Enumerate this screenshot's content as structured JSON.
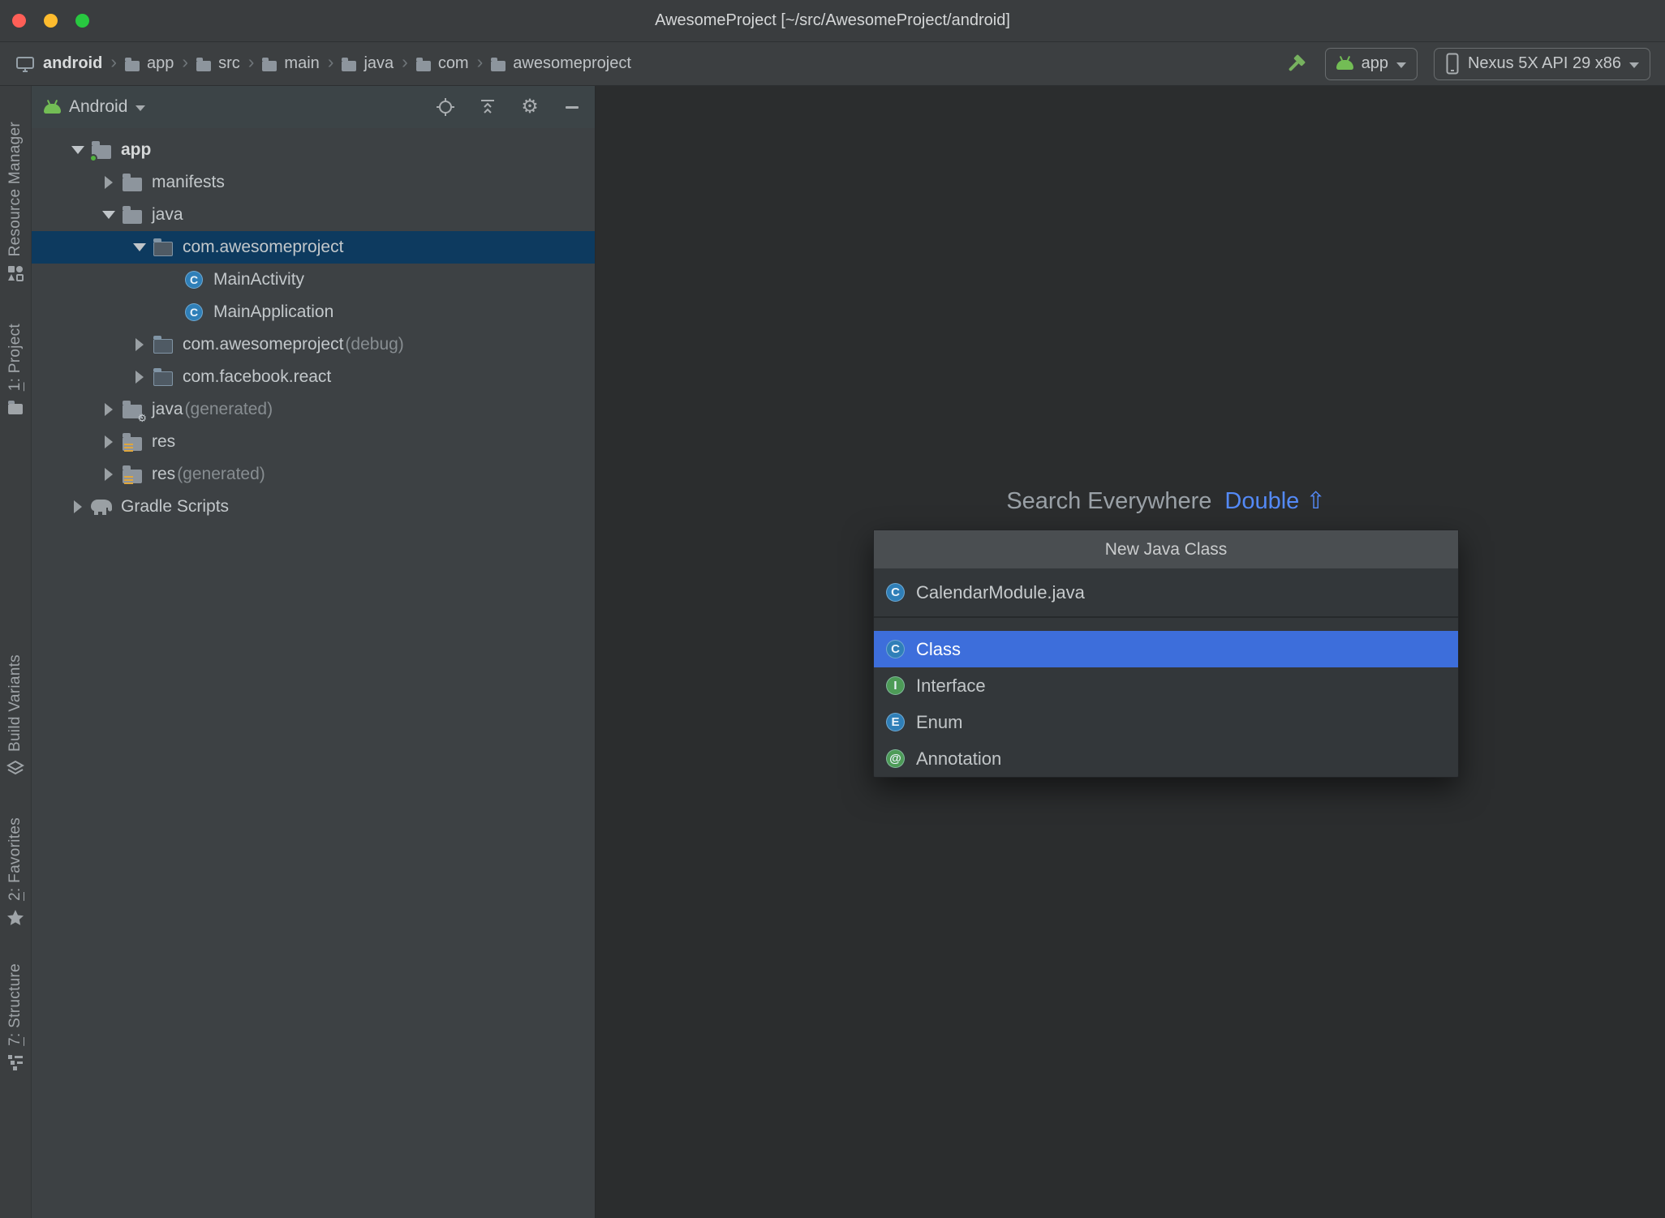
{
  "window": {
    "title": "AwesomeProject [~/src/AwesomeProject/android]"
  },
  "chrome": {
    "crumb_separator": "›"
  },
  "breadcrumbs": [
    "android",
    "app",
    "src",
    "main",
    "java",
    "com",
    "awesomeproject"
  ],
  "run_toolbar": {
    "config": "app",
    "device": "Nexus 5X API 29 x86"
  },
  "tool_window_header": {
    "view": "Android"
  },
  "tool_stripe": {
    "top": [
      {
        "mnemonic": "",
        "label": "Resource Manager"
      },
      {
        "mnemonic": "1",
        "label": ": Project"
      }
    ],
    "bottom": [
      {
        "mnemonic": "",
        "label": "Build Variants"
      },
      {
        "mnemonic": "2",
        "label": ": Favorites"
      },
      {
        "mnemonic": "7",
        "label": ": Structure"
      }
    ]
  },
  "icons": {
    "class_letter": "C"
  },
  "project_tree": {
    "items": [
      {
        "label": "app",
        "suffix": ""
      },
      {
        "label": "manifests",
        "suffix": ""
      },
      {
        "label": "java",
        "suffix": ""
      },
      {
        "label": "com.awesomeproject",
        "suffix": ""
      },
      {
        "label": "MainActivity",
        "suffix": ""
      },
      {
        "label": "MainApplication",
        "suffix": ""
      },
      {
        "label": "com.awesomeproject",
        "suffix": " (debug)"
      },
      {
        "label": "com.facebook.react",
        "suffix": ""
      },
      {
        "label": "java",
        "suffix": " (generated)"
      },
      {
        "label": "res",
        "suffix": ""
      },
      {
        "label": "res",
        "suffix": " (generated)"
      },
      {
        "label": "Gradle Scripts",
        "suffix": ""
      }
    ]
  },
  "editor": {
    "hint_label": "Search Everywhere",
    "hint_shortcut": "Double ⇧"
  },
  "popup": {
    "title": "New Java Class",
    "name_icon": "C",
    "name_value": "CalendarModule.java",
    "options": [
      {
        "icon": "C",
        "label": "Class",
        "selected": true
      },
      {
        "icon": "I",
        "label": "Interface",
        "selected": false
      },
      {
        "icon": "E",
        "label": "Enum",
        "selected": false
      },
      {
        "icon": "@",
        "label": "Annotation",
        "selected": false
      }
    ]
  },
  "colors": {
    "selection_blue": "#3d6edb",
    "shortcut_blue": "#548af7",
    "android_green": "#73bd55",
    "tree_selection_navy": "#0d3a5f"
  }
}
